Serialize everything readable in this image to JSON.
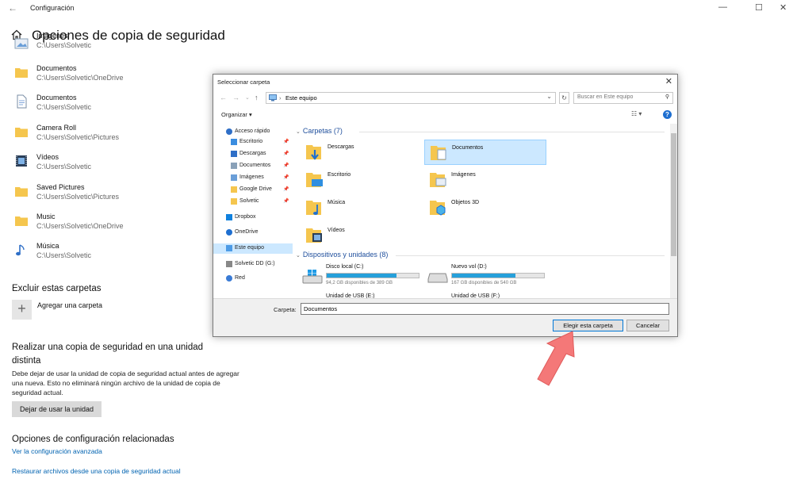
{
  "window": {
    "title": "Configuración",
    "back": "←",
    "min": "—",
    "max": "☐",
    "close": "✕"
  },
  "page": {
    "title": "Opciones de copia de seguridad"
  },
  "folders": [
    {
      "name": "Imágenes",
      "path": "C:\\Users\\Solvetic",
      "icon": "images-icon"
    },
    {
      "name": "Documentos",
      "path": "C:\\Users\\Solvetic\\OneDrive",
      "icon": "folder-icon"
    },
    {
      "name": "Documentos",
      "path": "C:\\Users\\Solvetic",
      "icon": "document-icon"
    },
    {
      "name": "Camera Roll",
      "path": "C:\\Users\\Solvetic\\Pictures",
      "icon": "folder-icon"
    },
    {
      "name": "Vídeos",
      "path": "C:\\Users\\Solvetic",
      "icon": "video-icon"
    },
    {
      "name": "Saved Pictures",
      "path": "C:\\Users\\Solvetic\\Pictures",
      "icon": "folder-icon"
    },
    {
      "name": "Music",
      "path": "C:\\Users\\Solvetic\\OneDrive",
      "icon": "folder-icon"
    },
    {
      "name": "Música",
      "path": "C:\\Users\\Solvetic",
      "icon": "music-icon"
    }
  ],
  "exclude": {
    "heading": "Excluir estas carpetas",
    "add_label": "Agregar una carpeta",
    "add_symbol": "+"
  },
  "other_drive": {
    "heading_line1": "Realizar una copia de seguridad en una unidad",
    "heading_line2": "distinta",
    "description": "Debe dejar de usar la unidad de copia de seguridad actual antes de agregar una nueva. Esto no eliminará ningún archivo de la unidad de copia de seguridad actual.",
    "button": "Dejar de usar la unidad"
  },
  "related": {
    "heading": "Opciones de configuración relacionadas",
    "link1": "Ver la configuración avanzada",
    "link2": "Restaurar archivos desde una copia de seguridad actual"
  },
  "dialog": {
    "title": "Seleccionar carpeta",
    "close": "✕",
    "address": "Este equipo",
    "address_sep": "›",
    "search_placeholder": "Buscar en Este equipo",
    "organize": "Organizar ▾",
    "help": "?",
    "nav": [
      {
        "label": "Acceso rápido",
        "pinned": false,
        "icon": "star-icon",
        "selected": false
      },
      {
        "label": "Escritorio",
        "pinned": true,
        "icon": "desktop-icon",
        "selected": false
      },
      {
        "label": "Descargas",
        "pinned": true,
        "icon": "download-icon",
        "selected": false
      },
      {
        "label": "Documentos",
        "pinned": true,
        "icon": "document-icon",
        "selected": false
      },
      {
        "label": "Imágenes",
        "pinned": true,
        "icon": "images-icon",
        "selected": false
      },
      {
        "label": "Google Drive",
        "pinned": true,
        "icon": "folder-icon",
        "selected": false
      },
      {
        "label": "Solvetic",
        "pinned": true,
        "icon": "folder-icon",
        "selected": false
      },
      {
        "label": "Dropbox",
        "pinned": false,
        "icon": "dropbox-icon",
        "selected": false
      },
      {
        "label": "OneDrive",
        "pinned": false,
        "icon": "cloud-icon",
        "selected": false
      },
      {
        "label": "Este equipo",
        "pinned": false,
        "icon": "computer-icon",
        "selected": true
      },
      {
        "label": "Solvetic DD (G:)",
        "pinned": false,
        "icon": "drive-icon",
        "selected": false
      },
      {
        "label": "Red",
        "pinned": false,
        "icon": "network-icon",
        "selected": false
      }
    ],
    "group_folders": "Carpetas (7)",
    "folders": [
      {
        "label": "Descargas",
        "icon": "download-folder-icon",
        "selected": false
      },
      {
        "label": "Documentos",
        "icon": "document-folder-icon",
        "selected": true
      },
      {
        "label": "Escritorio",
        "icon": "desktop-folder-icon",
        "selected": false
      },
      {
        "label": "Imágenes",
        "icon": "images-folder-icon",
        "selected": false
      },
      {
        "label": "Música",
        "icon": "music-folder-icon",
        "selected": false
      },
      {
        "label": "Objetos 3D",
        "icon": "objects3d-folder-icon",
        "selected": false
      },
      {
        "label": "Vídeos",
        "icon": "video-folder-icon",
        "selected": false
      }
    ],
    "group_drives": "Dispositivos y unidades (8)",
    "drives": [
      {
        "label": "Disco local (C:)",
        "free": "94,2 GB disponibles de 389 GB",
        "used_fraction": 0.76,
        "icon": "windows-drive-icon"
      },
      {
        "label": "Nuevo vol (D:)",
        "free": "167 GB disponibles de 540 GB",
        "used_fraction": 0.69,
        "icon": "drive-icon"
      },
      {
        "label": "Unidad de USB (E:)"
      },
      {
        "label": "Unidad de USB (F:)"
      }
    ],
    "folder_label": "Carpeta:",
    "folder_value": "Documentos",
    "choose_button": "Elegir esta carpeta",
    "cancel_button": "Cancelar"
  },
  "colors": {
    "accent": "#0078d7",
    "link": "#0063b1",
    "selection": "#cce8ff",
    "arrow": "#f47878",
    "folder": "#f5c64e"
  }
}
